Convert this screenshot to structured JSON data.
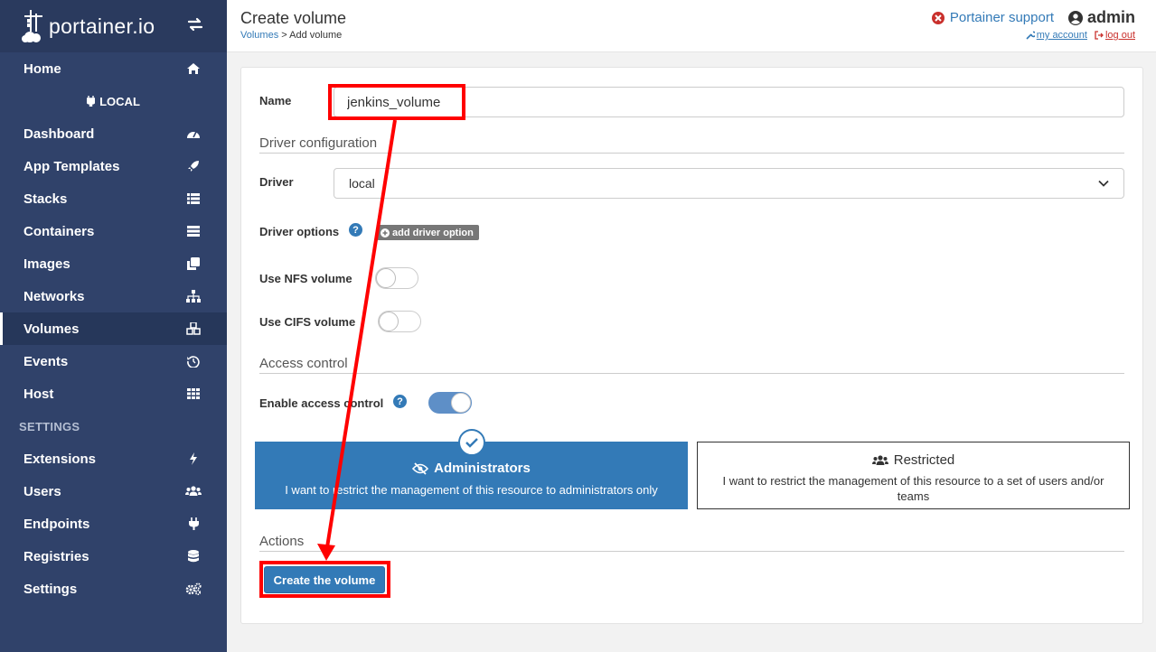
{
  "sidebar": {
    "brand": "portainer.io",
    "endpoint": "LOCAL",
    "settings_heading": "SETTINGS",
    "items": [
      {
        "label": "Home",
        "icon": "home-icon"
      },
      {
        "label": "Dashboard",
        "icon": "dashboard-icon"
      },
      {
        "label": "App Templates",
        "icon": "rocket-icon"
      },
      {
        "label": "Stacks",
        "icon": "th-list-icon"
      },
      {
        "label": "Containers",
        "icon": "server-icon"
      },
      {
        "label": "Images",
        "icon": "clone-icon"
      },
      {
        "label": "Networks",
        "icon": "sitemap-icon"
      },
      {
        "label": "Volumes",
        "icon": "cubes-icon",
        "active": true
      },
      {
        "label": "Events",
        "icon": "history-icon"
      },
      {
        "label": "Host",
        "icon": "th-icon"
      }
    ],
    "settings_items": [
      {
        "label": "Extensions",
        "icon": "bolt-icon"
      },
      {
        "label": "Users",
        "icon": "users-icon"
      },
      {
        "label": "Endpoints",
        "icon": "plug-icon"
      },
      {
        "label": "Registries",
        "icon": "database-icon"
      },
      {
        "label": "Settings",
        "icon": "cogs-icon"
      }
    ]
  },
  "header": {
    "title": "Create volume",
    "breadcrumb_link": "Volumes",
    "breadcrumb_current": " > Add volume",
    "support": "Portainer support",
    "user": "admin",
    "my_account": "my account",
    "log_out": "log out"
  },
  "form": {
    "name_label": "Name",
    "name_value": "jenkins_volume",
    "driver_config_title": "Driver configuration",
    "driver_label": "Driver",
    "driver_value": "local",
    "driver_options_label": "Driver options",
    "add_driver_option": "add driver option",
    "nfs_label": "Use NFS volume",
    "nfs_on": false,
    "cifs_label": "Use CIFS volume",
    "cifs_on": false,
    "access_control_title": "Access control",
    "enable_access_label": "Enable access control",
    "enable_access_on": true,
    "admin_box_title": "Administrators",
    "admin_box_desc": "I want to restrict the management of this resource to administrators only",
    "restricted_box_title": "Restricted",
    "restricted_box_desc": "I want to restrict the management of this resource to a set of users and/or teams",
    "actions_title": "Actions",
    "create_button": "Create the volume"
  },
  "colors": {
    "sidebar": "#30426a",
    "primary": "#337ab7",
    "annotation": "#ff0000"
  }
}
